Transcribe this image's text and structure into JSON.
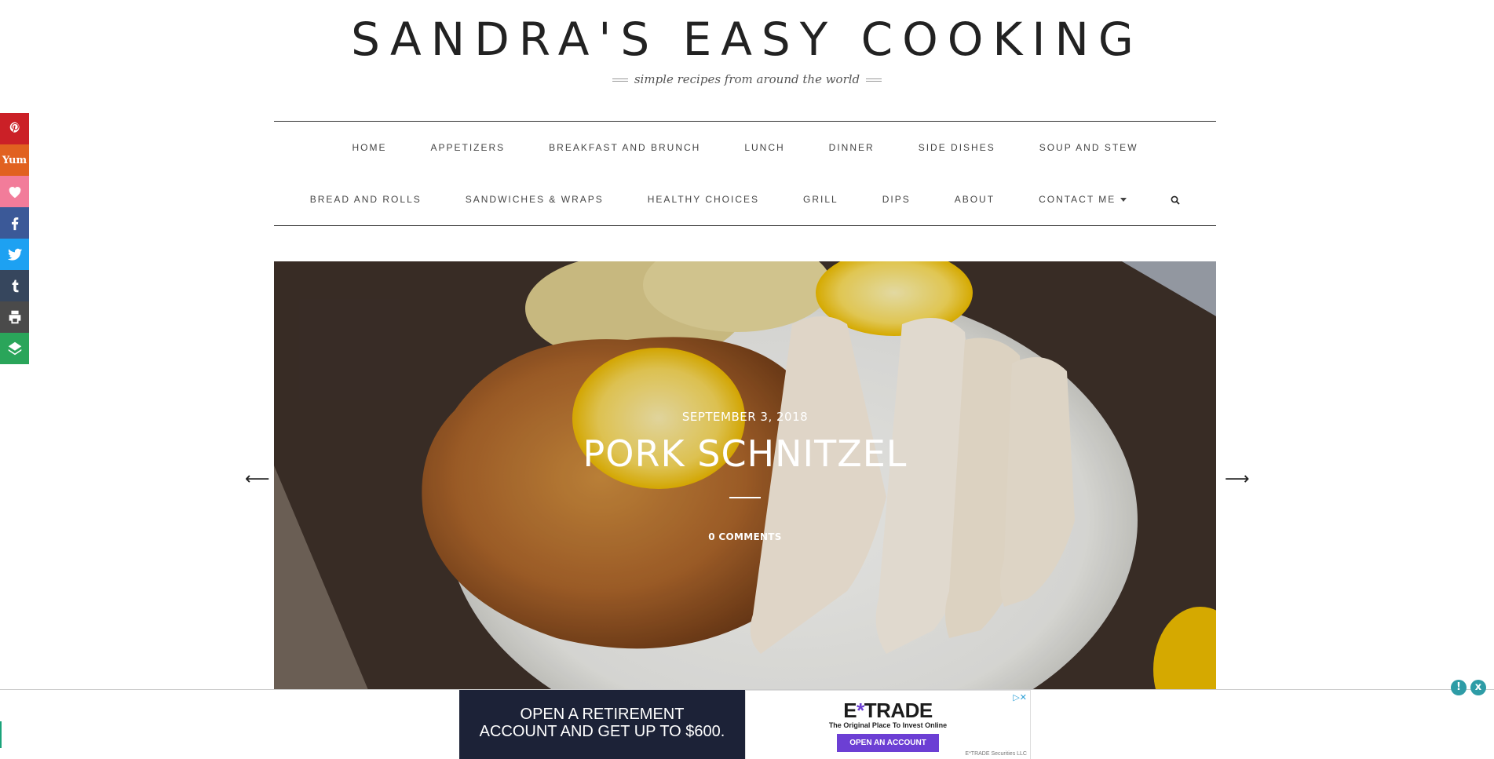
{
  "header": {
    "title": "SANDRA'S EASY COOKING",
    "tagline": "simple recipes from around the world"
  },
  "nav": {
    "row1": [
      "HOME",
      "APPETIZERS",
      "BREAKFAST AND BRUNCH",
      "LUNCH",
      "DINNER",
      "SIDE DISHES",
      "SOUP AND STEW"
    ],
    "row2": [
      "BREAD AND ROLLS",
      "SANDWICHES & WRAPS",
      "HEALTHY CHOICES",
      "GRILL",
      "DIPS",
      "ABOUT",
      "CONTACT ME"
    ]
  },
  "share": {
    "items": [
      {
        "icon": "pinterest-icon",
        "color": "#cb2027"
      },
      {
        "icon": "yummly-icon",
        "color": "#e16120"
      },
      {
        "icon": "favorite-heart-icon",
        "color": "#f27c9a"
      },
      {
        "icon": "facebook-icon",
        "color": "#3b5998"
      },
      {
        "icon": "twitter-icon",
        "color": "#1da1f2"
      },
      {
        "icon": "tumblr-icon",
        "color": "#36465d"
      },
      {
        "icon": "print-icon",
        "color": "#4a4a4a"
      },
      {
        "icon": "more-share-icon",
        "color": "#2aa55a"
      }
    ],
    "yummly_label": "Yum"
  },
  "hero": {
    "date": "SEPTEMBER 3, 2018",
    "title": "PORK SCHNITZEL",
    "comments": "0 COMMENTS",
    "prev_arrow": "⟵",
    "next_arrow": "⟶"
  },
  "ad": {
    "headline_line1": "OPEN A RETIREMENT",
    "headline_line2": "ACCOUNT AND GET UP TO $600.",
    "brand_left": "E",
    "brand_star": "*",
    "brand_right": "TRADE",
    "brand_sub": "The Original Place To Invest Online",
    "cta": "OPEN AN ACCOUNT",
    "legal": "E*TRADE Securities LLC",
    "choices": "▷✕",
    "info": "!",
    "close": "x"
  }
}
